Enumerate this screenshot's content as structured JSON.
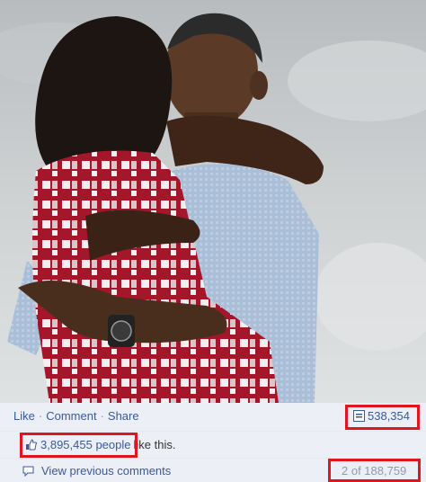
{
  "post": {
    "actions": {
      "like": "Like",
      "comment": "Comment",
      "share": "Share",
      "separator": "·"
    },
    "share_count": "538,354",
    "likes": {
      "count_text": "3,895,455 people",
      "suffix": "like this."
    },
    "comments": {
      "view_previous": "View previous comments",
      "pager": "2 of 188,759"
    }
  },
  "colors": {
    "link": "#3b5998",
    "bar": "#eceff5",
    "highlight": "#e0161e"
  },
  "icons": {
    "share": "share-count-icon",
    "like": "thumbs-up-icon",
    "comment": "comment-bubble-icon"
  }
}
